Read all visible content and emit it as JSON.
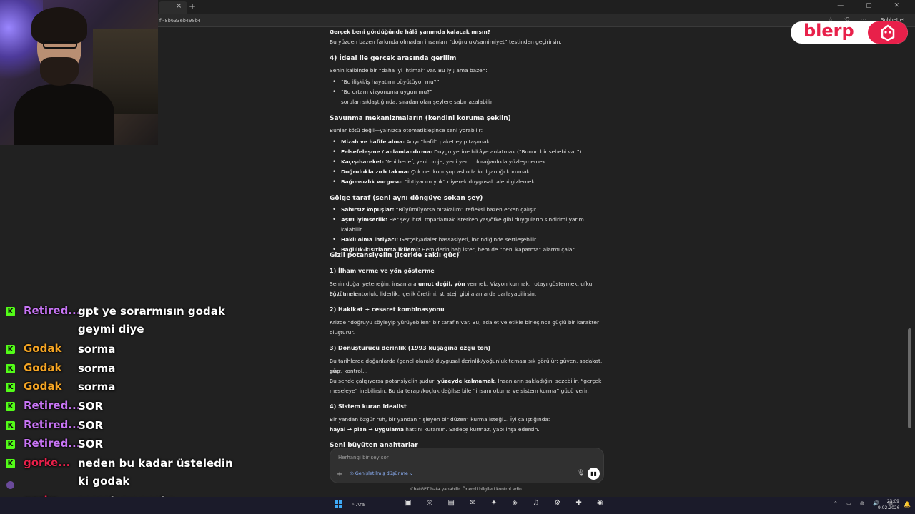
{
  "browser": {
    "tab_close": "×",
    "new_tab": "+",
    "url": "f-8b633eb490b4",
    "share_label": "Sohbet et",
    "window_controls": "— ▢ ✕",
    "toolbar_icons": "☆ ⟲ ⋯"
  },
  "overlay": {
    "blerp_text": "blerp"
  },
  "chat": [
    {
      "user": "Retired...",
      "color": "#c774f4",
      "lines": [
        "gpt ye sorarmısın godak",
        "geymi diye"
      ]
    },
    {
      "user": "Godak",
      "color": "#f5a524",
      "lines": [
        "sorma"
      ]
    },
    {
      "user": "Godak",
      "color": "#f5a524",
      "lines": [
        "sorma"
      ]
    },
    {
      "user": "Godak",
      "color": "#f5a524",
      "lines": [
        "sorma"
      ]
    },
    {
      "user": "Retired...",
      "color": "#c774f4",
      "lines": [
        "SOR"
      ]
    },
    {
      "user": "Retired...",
      "color": "#c774f4",
      "lines": [
        "SOR"
      ]
    },
    {
      "user": "Retired...",
      "color": "#c774f4",
      "lines": [
        "SOR"
      ]
    },
    {
      "user": "gorke...",
      "color": "#e8204a",
      "lines": [
        "neden bu kadar üsteledin",
        "ki godak"
      ]
    },
    {
      "user": "gorke...",
      "color": "#e8204a",
      "lines": [
        "sorsak mı acaba"
      ]
    }
  ],
  "chat_badge": "K",
  "content": {
    "p0_b": "Gerçek beni gördüğünde hâlâ yanımda kalacak mısın?",
    "p0": "Bu yüzden bazen farkında olmadan insanları “doğruluk/samimiyet” testinden geçirirsin.",
    "h_ideal": "4) İdeal ile gerçek arasında gerilim",
    "p_ideal": "Senin kalbinde bir “daha iyi ihtimal” var. Bu iyi; ama bazen:",
    "ideal_items": [
      "“Bu ilişki/iş hayatımı büyütüyor mu?”",
      "“Bu ortam vizyonuma uygun mu?”"
    ],
    "ideal_tail": "soruları sıklaştığında, sıradan olan şeylere sabır azalabilir.",
    "h_savunma": "Savunma mekanizmaların (kendini koruma şeklin)",
    "p_savunma": "Bunlar kötü değil—yalnızca otomatikleşince seni yorabilir:",
    "savunma_items": [
      {
        "b": "Mizah ve hafife alma:",
        "t": " Acıyı “hafif” paketleyip taşımak."
      },
      {
        "b": "Felsefeleşme / anlamlandırma:",
        "t": " Duygu yerine hikâye anlatmak (“Bunun bir sebebi var”)."
      },
      {
        "b": "Kaçış-hareket:",
        "t": " Yeni hedef, yeni proje, yeni yer… durağanlıkla yüzleşmemek."
      },
      {
        "b": "Doğrulukla zırh takma:",
        "t": " Çok net konuşup aslında kırılganlığı korumak."
      },
      {
        "b": "Bağımsızlık vurgusu:",
        "t": " “İhtiyacım yok” diyerek duygusal talebi gizlemek."
      }
    ],
    "h_golge": "Gölge taraf (seni aynı döngüye sokan şey)",
    "golge_items": [
      {
        "b": "Sabırsız kopuşlar:",
        "t": " “Büyümüyorsa bırakalım” refleksi bazen erken çalışır."
      },
      {
        "b": "Aşırı iyimserlik:",
        "t": " Her şeyi hızlı toparlamak isterken yas/öfke gibi duyguların sindirimi yarım kalabilir."
      },
      {
        "b": "Haklı olma ihtiyacı:",
        "t": " Gerçek/adalet hassasiyeti, incindiğinde sertleşebilir."
      },
      {
        "b": "Bağlılık-kısıtlanma ikilemi:",
        "t": " Hem derin bağ ister, hem de “beni kapatma” alarmı çalar."
      }
    ],
    "h_gizli": "Gizli potansiyelin (içeride saklı güç)",
    "h_ilham": "1) İlham verme ve yön gösterme",
    "p_ilham_1": "Senin doğal yeteneğin: insanlara ",
    "p_ilham_b": "umut değil, yön",
    "p_ilham_2": " vermek. Vizyon kurmak, rotayı göstermek, ufku büyütmek.",
    "p_ilham_3": "Eğitim, mentorluk, liderlik, içerik üretimi, strateji gibi alanlarda parlayabilirsin.",
    "h_hakikat": "2) Hakikat + cesaret kombinasyonu",
    "p_hakikat_1": "Krizde “doğruyu söyleyip yürüyebilen” bir tarafın var. Bu, adalet ve etikle birleşince güçlü bir karakter",
    "p_hakikat_2": "oluşturur.",
    "h_donusturucu": "3) Dönüştürücü derinlik (1993 kuşağına özgü ton)",
    "p_don_1": "Bu tarihlerde doğanlarda (genel olarak) duygusal derinlik/yoğunluk teması sık görülür: güven, sadakat, güç,",
    "p_don_2": "sınır, kontrol…",
    "p_don_3a": "Bu sende çalışıyorsa potansiyelin şudur: ",
    "p_don_3b": "yüzeyde kalmamak",
    "p_don_3c": ". İnsanların sakladığını sezebilir, “gerçek",
    "p_don_4": "meseleye” inebilirsin. Bu da terapi/koçluk değilse bile “insanı okuma ve sistem kurma” gücü verir.",
    "h_sistem": "4) Sistem kuran idealist",
    "p_sis_1": "Bir yandan özgür ruh, bir yandan “işleyen bir düzen” kurma isteği… İyi çalıştığında:",
    "p_sis_2b": "hayal → plan → uygulama",
    "p_sis_2": " hattını kurarsın. Sadece kurmaz, yapı inşa edersin.",
    "h_seni": "Seni büyüten anahtarlar"
  },
  "input": {
    "placeholder": "Herhangi bir şey sor",
    "think_label": "Genişletilmiş düşünme",
    "disclaimer": "ChatGPT hata yapabilir. Önemli bilgileri kontrol edin."
  },
  "taskbar": {
    "search_label": "Ara",
    "time": "23:09",
    "date": "9.02.2026",
    "apps": "▣ ◎ ▤ ✉ ✦ ◈ ♫ ⚙ ✚ ◉"
  }
}
